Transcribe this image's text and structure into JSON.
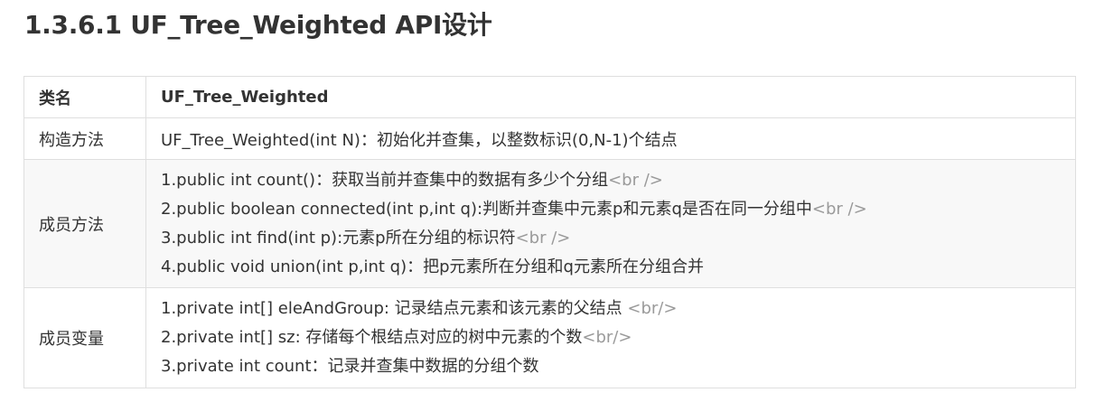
{
  "heading": "1.3.6.1 UF_Tree_Weighted API设计",
  "table": {
    "header": {
      "label": "类名",
      "value": "UF_Tree_Weighted"
    },
    "constructor": {
      "label": "构造方法",
      "value": "UF_Tree_Weighted(int N)：初始化并查集，以整数标识(0,N-1)个结点"
    },
    "methods": {
      "label": "成员方法",
      "lines": [
        {
          "text": "1.public int count()：获取当前并查集中的数据有多少个分组",
          "tag": "<br />"
        },
        {
          "text": "2.public boolean connected(int p,int q):判断并查集中元素p和元素q是否在同一分组中",
          "tag": "<br />"
        },
        {
          "text": "3.public int find(int p):元素p所在分组的标识符",
          "tag": "<br />"
        },
        {
          "text": "4.public void union(int p,int q)：把p元素所在分组和q元素所在分组合并",
          "tag": ""
        }
      ]
    },
    "fields": {
      "label": "成员变量",
      "lines": [
        {
          "text": "1.private int[]  eleAndGroup: 记录结点元素和该元素的父结点 ",
          "tag": "<br/>"
        },
        {
          "text": "2.private int[] sz: 存储每个根结点对应的树中元素的个数",
          "tag": "<br/>"
        },
        {
          "text": "3.private int count：记录并查集中数据的分组个数",
          "tag": ""
        }
      ]
    }
  }
}
